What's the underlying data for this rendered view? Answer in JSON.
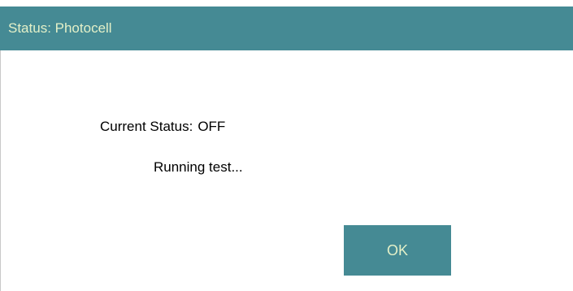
{
  "dialog": {
    "title": "Status: Photocell",
    "status_label": "Current Status:",
    "status_value": "OFF",
    "message": "Running test...",
    "ok_label": "OK"
  },
  "colors": {
    "accent": "#458a94",
    "title_text": "#e3f0c8",
    "body_text": "#000000",
    "background": "#ffffff"
  }
}
